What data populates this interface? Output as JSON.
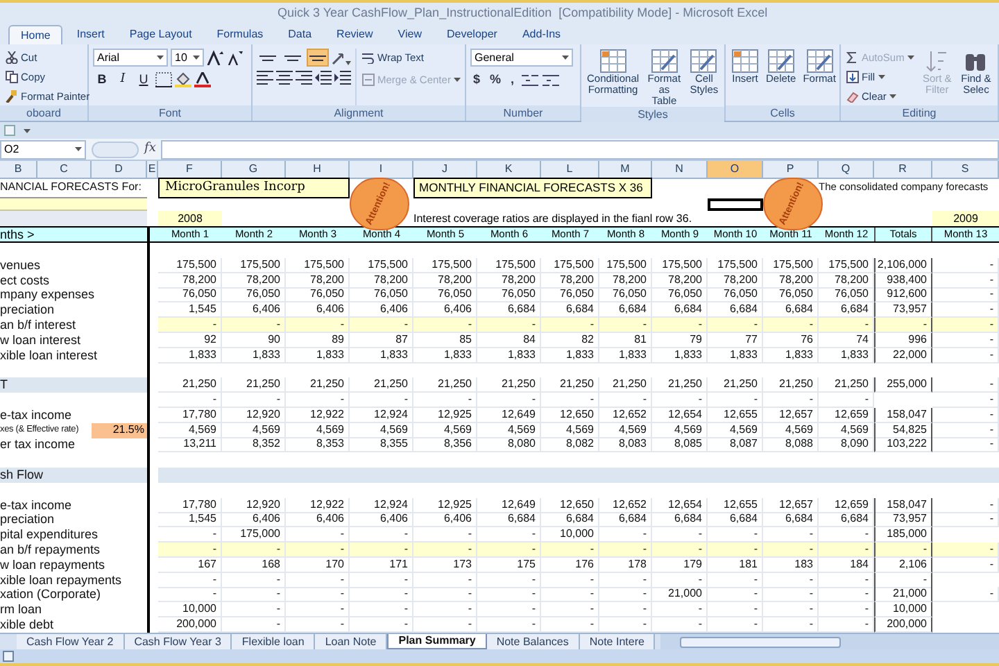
{
  "window": {
    "title": "Quick 3 Year CashFlow_Plan_InstructionalEdition  [Compatibility Mode] - Microsoft Excel"
  },
  "ribbon_tabs": [
    {
      "label": "Home",
      "selected": true
    },
    {
      "label": "Insert",
      "selected": false
    },
    {
      "label": "Page Layout",
      "selected": false
    },
    {
      "label": "Formulas",
      "selected": false
    },
    {
      "label": "Data",
      "selected": false
    },
    {
      "label": "Review",
      "selected": false
    },
    {
      "label": "View",
      "selected": false
    },
    {
      "label": "Developer",
      "selected": false
    },
    {
      "label": "Add-Ins",
      "selected": false
    }
  ],
  "ribbon_groups": [
    {
      "kind": "clipboard",
      "label": "oboard",
      "items": [
        {
          "label": "Cut",
          "disabled": false
        },
        {
          "label": "Copy",
          "disabled": false
        },
        {
          "label": "Format Painter",
          "disabled": false
        }
      ]
    },
    {
      "kind": "font",
      "label": "Font",
      "font_name": "Arial",
      "font_size": "10",
      "format_buttons": [
        "B",
        "I",
        "U"
      ]
    },
    {
      "kind": "alignment",
      "label": "Alignment",
      "vertical_align": [
        {
          "selected": false
        },
        {
          "selected": false
        },
        {
          "selected": true
        }
      ],
      "items": [
        {
          "label": "Wrap Text",
          "disabled": false
        },
        {
          "label": "Merge & Center",
          "disabled": true
        }
      ]
    },
    {
      "kind": "number",
      "label": "Number",
      "format": "General",
      "format_buttons": [
        "$",
        "%",
        ","
      ]
    },
    {
      "kind": "styles",
      "label": "Styles",
      "items": [
        {
          "label": "Conditional Formatting",
          "disabled": false
        },
        {
          "label": "Format as Table",
          "disabled": false
        },
        {
          "label": "Cell Styles",
          "disabled": false
        }
      ]
    },
    {
      "kind": "cells",
      "label": "Cells",
      "items": [
        {
          "label": "Insert",
          "disabled": false
        },
        {
          "label": "Delete",
          "disabled": false
        },
        {
          "label": "Format",
          "disabled": false
        }
      ]
    },
    {
      "kind": "editing",
      "label": "Editing",
      "items": [
        {
          "label": "AutoSum",
          "disabled": true
        },
        {
          "label": "Fill",
          "disabled": false
        },
        {
          "label": "Clear",
          "disabled": false
        }
      ],
      "big_items": [
        {
          "label": "Sort & Filter",
          "disabled": true
        },
        {
          "label": "Find & Selec",
          "disabled": false
        }
      ]
    }
  ],
  "formula_bar": {
    "name_box": "O2",
    "fx": "fx"
  },
  "columns": [
    {
      "label": "B",
      "selected": false
    },
    {
      "label": "C",
      "selected": false
    },
    {
      "label": "D",
      "selected": false
    },
    {
      "label": "E",
      "selected": false
    },
    {
      "label": "F",
      "selected": false
    },
    {
      "label": "G",
      "selected": false
    },
    {
      "label": "H",
      "selected": false
    },
    {
      "label": "I",
      "selected": false
    },
    {
      "label": "J",
      "selected": false
    },
    {
      "label": "K",
      "selected": false
    },
    {
      "label": "L",
      "selected": false
    },
    {
      "label": "M",
      "selected": false
    },
    {
      "label": "N",
      "selected": false
    },
    {
      "label": "O",
      "selected": true
    },
    {
      "label": "P",
      "selected": false
    },
    {
      "label": "Q",
      "selected": false
    },
    {
      "label": "R",
      "selected": false
    },
    {
      "label": "S",
      "selected": false
    }
  ],
  "header": {
    "title_label": "NANCIAL FORECASTS For:",
    "company": "MicroGranules Incorp",
    "forecast_title": "MONTHLY FINANCIAL FORECASTS X 36",
    "note_right": "The consolidated company forecasts",
    "year_1": "2008",
    "note": "Interest coverage ratios are displayed in the fianl row 36.",
    "year_2": "2009",
    "months_label": "nths >",
    "stamps": [
      "Attention!",
      "Attention!"
    ]
  },
  "month_headers": [
    "Month 1",
    "Month 2",
    "Month 3",
    "Month 4",
    "Month 5",
    "Month 6",
    "Month 7",
    "Month 8",
    "Month 9",
    "Month 10",
    "Month 11",
    "Month 12",
    "Totals",
    "Month 13"
  ],
  "rows": [
    {
      "kind": "blank"
    },
    {
      "kind": "data",
      "label": "venues",
      "values": {
        "m1": "175,500",
        "m2": "175,500",
        "m3": "175,500",
        "m4": "175,500",
        "m5": "175,500",
        "m6": "175,500",
        "m7": "175,500",
        "m8": "175,500",
        "m9": "175,500",
        "m10": "175,500",
        "m11": "175,500",
        "m12": "175,500",
        "totals": "2,106,000",
        "m13": "-"
      }
    },
    {
      "kind": "data",
      "label": "ect costs",
      "values": {
        "m1": "78,200",
        "m2": "78,200",
        "m3": "78,200",
        "m4": "78,200",
        "m5": "78,200",
        "m6": "78,200",
        "m7": "78,200",
        "m8": "78,200",
        "m9": "78,200",
        "m10": "78,200",
        "m11": "78,200",
        "m12": "78,200",
        "totals": "938,400",
        "m13": "-"
      }
    },
    {
      "kind": "data",
      "label": "mpany expenses",
      "values": {
        "m1": "76,050",
        "m2": "76,050",
        "m3": "76,050",
        "m4": "76,050",
        "m5": "76,050",
        "m6": "76,050",
        "m7": "76,050",
        "m8": "76,050",
        "m9": "76,050",
        "m10": "76,050",
        "m11": "76,050",
        "m12": "76,050",
        "totals": "912,600",
        "m13": "-"
      }
    },
    {
      "kind": "data",
      "label": "preciation",
      "values": {
        "m1": "1,545",
        "m2": "6,406",
        "m3": "6,406",
        "m4": "6,406",
        "m5": "6,406",
        "m6": "6,684",
        "m7": "6,684",
        "m8": "6,684",
        "m9": "6,684",
        "m10": "6,684",
        "m11": "6,684",
        "m12": "6,684",
        "totals": "73,957",
        "m13": "-"
      }
    },
    {
      "kind": "input",
      "label": "an b/f interest",
      "values": {
        "m1": "-",
        "m2": "-",
        "m3": "-",
        "m4": "-",
        "m5": "-",
        "m6": "-",
        "m7": "-",
        "m8": "-",
        "m9": "-",
        "m10": "-",
        "m11": "-",
        "m12": "-",
        "totals": "-",
        "m13": "-"
      }
    },
    {
      "kind": "data",
      "label": "w loan interest",
      "values": {
        "m1": "92",
        "m2": "90",
        "m3": "89",
        "m4": "87",
        "m5": "85",
        "m6": "84",
        "m7": "82",
        "m8": "81",
        "m9": "79",
        "m10": "77",
        "m11": "76",
        "m12": "74",
        "totals": "996",
        "m13": "-"
      }
    },
    {
      "kind": "data",
      "label": "xible loan interest",
      "values": {
        "m1": "1,833",
        "m2": "1,833",
        "m3": "1,833",
        "m4": "1,833",
        "m5": "1,833",
        "m6": "1,833",
        "m7": "1,833",
        "m8": "1,833",
        "m9": "1,833",
        "m10": "1,833",
        "m11": "1,833",
        "m12": "1,833",
        "totals": "22,000",
        "m13": "-"
      }
    },
    {
      "kind": "blank"
    },
    {
      "kind": "section",
      "label": "T",
      "values": {
        "m1": "21,250",
        "m2": "21,250",
        "m3": "21,250",
        "m4": "21,250",
        "m5": "21,250",
        "m6": "21,250",
        "m7": "21,250",
        "m8": "21,250",
        "m9": "21,250",
        "m10": "21,250",
        "m11": "21,250",
        "m12": "21,250",
        "totals": "255,000",
        "m13": "-"
      }
    },
    {
      "kind": "data",
      "values": {
        "m1": "-",
        "m2": "-",
        "m3": "-",
        "m4": "-",
        "m5": "-",
        "m6": "-",
        "m7": "-",
        "m8": "-",
        "m9": "-",
        "m10": "-",
        "m11": "-",
        "m12": "-",
        "m13": "-"
      }
    },
    {
      "kind": "data",
      "label": "e-tax income",
      "values": {
        "m1": "17,780",
        "m2": "12,920",
        "m3": "12,922",
        "m4": "12,924",
        "m5": "12,925",
        "m6": "12,649",
        "m7": "12,650",
        "m8": "12,652",
        "m9": "12,654",
        "m10": "12,655",
        "m11": "12,657",
        "m12": "12,659",
        "totals": "158,047",
        "m13": "-"
      }
    },
    {
      "kind": "data",
      "label": "xes (& Effective rate)",
      "rate": "21.5%",
      "values": {
        "m1": "4,569",
        "m2": "4,569",
        "m3": "4,569",
        "m4": "4,569",
        "m5": "4,569",
        "m6": "4,569",
        "m7": "4,569",
        "m8": "4,569",
        "m9": "4,569",
        "m10": "4,569",
        "m11": "4,569",
        "m12": "4,569",
        "totals": "54,825",
        "m13": "-"
      }
    },
    {
      "kind": "data",
      "label": "er tax income",
      "values": {
        "m1": "13,211",
        "m2": "8,352",
        "m3": "8,353",
        "m4": "8,355",
        "m5": "8,356",
        "m6": "8,080",
        "m7": "8,082",
        "m8": "8,083",
        "m9": "8,085",
        "m10": "8,087",
        "m11": "8,088",
        "m12": "8,090",
        "totals": "103,222",
        "m13": "-"
      }
    },
    {
      "kind": "blank"
    },
    {
      "kind": "section",
      "label": "sh Flow"
    },
    {
      "kind": "blank"
    },
    {
      "kind": "data",
      "label": "e-tax income",
      "values": {
        "m1": "17,780",
        "m2": "12,920",
        "m3": "12,922",
        "m4": "12,924",
        "m5": "12,925",
        "m6": "12,649",
        "m7": "12,650",
        "m8": "12,652",
        "m9": "12,654",
        "m10": "12,655",
        "m11": "12,657",
        "m12": "12,659",
        "totals": "158,047",
        "m13": "-"
      }
    },
    {
      "kind": "data",
      "label": "preciation",
      "values": {
        "m1": "1,545",
        "m2": "6,406",
        "m3": "6,406",
        "m4": "6,406",
        "m5": "6,406",
        "m6": "6,684",
        "m7": "6,684",
        "m8": "6,684",
        "m9": "6,684",
        "m10": "6,684",
        "m11": "6,684",
        "m12": "6,684",
        "totals": "73,957",
        "m13": "-"
      }
    },
    {
      "kind": "data",
      "label": "pital expenditures",
      "values": {
        "m1": "-",
        "m2": "175,000",
        "m3": "-",
        "m4": "-",
        "m5": "-",
        "m6": "-",
        "m7": "10,000",
        "m8": "-",
        "m9": "-",
        "m10": "-",
        "m11": "-",
        "m12": "-",
        "totals": "185,000"
      }
    },
    {
      "kind": "input",
      "label": "an b/f repayments",
      "values": {
        "m1": "-",
        "m2": "-",
        "m3": "-",
        "m4": "-",
        "m5": "-",
        "m6": "-",
        "m7": "-",
        "m8": "-",
        "m9": "-",
        "m10": "-",
        "m11": "-",
        "m12": "-",
        "totals": "-",
        "m13": "-"
      }
    },
    {
      "kind": "data",
      "label": "w loan repayments",
      "values": {
        "m1": "167",
        "m2": "168",
        "m3": "170",
        "m4": "171",
        "m5": "173",
        "m6": "175",
        "m7": "176",
        "m8": "178",
        "m9": "179",
        "m10": "181",
        "m11": "183",
        "m12": "184",
        "totals": "2,106",
        "m13": "-"
      }
    },
    {
      "kind": "data",
      "label": "xible loan repayments",
      "values": {
        "m1": "-",
        "m2": "-",
        "m3": "-",
        "m4": "-",
        "m5": "-",
        "m6": "-",
        "m7": "-",
        "m8": "-",
        "m9": "-",
        "m10": "-",
        "m11": "-",
        "m12": "-",
        "totals": "-"
      }
    },
    {
      "kind": "data",
      "label": "xation (Corporate)",
      "values": {
        "m1": "-",
        "m2": "-",
        "m3": "-",
        "m4": "-",
        "m5": "-",
        "m6": "-",
        "m7": "-",
        "m8": "-",
        "m9": "21,000",
        "m10": "-",
        "m11": "-",
        "m12": "-",
        "totals": "21,000",
        "m13": "-"
      }
    },
    {
      "kind": "data",
      "label": "rm loan",
      "values": {
        "m1": "10,000",
        "m2": "-",
        "m3": "-",
        "m4": "-",
        "m5": "-",
        "m6": "-",
        "m7": "-",
        "m8": "-",
        "m9": "-",
        "m10": "-",
        "m11": "-",
        "m12": "-",
        "totals": "10,000"
      }
    },
    {
      "kind": "data",
      "label": "xible debt",
      "values": {
        "m1": "200,000",
        "m2": "-",
        "m3": "-",
        "m4": "-",
        "m5": "-",
        "m6": "-",
        "m7": "-",
        "m8": "-",
        "m9": "-",
        "m10": "-",
        "m11": "-",
        "m12": "-",
        "totals": "200,000"
      }
    }
  ],
  "sheet_tabs": [
    {
      "label": "Cash Flow Year 2",
      "selected": false
    },
    {
      "label": "Cash Flow Year 3",
      "selected": false
    },
    {
      "label": "Flexible loan",
      "selected": false
    },
    {
      "label": "Loan Note",
      "selected": false
    },
    {
      "label": "Plan Summary",
      "selected": true
    },
    {
      "label": "Note Balances",
      "selected": false
    },
    {
      "label": "Note Intere",
      "selected": false
    }
  ]
}
